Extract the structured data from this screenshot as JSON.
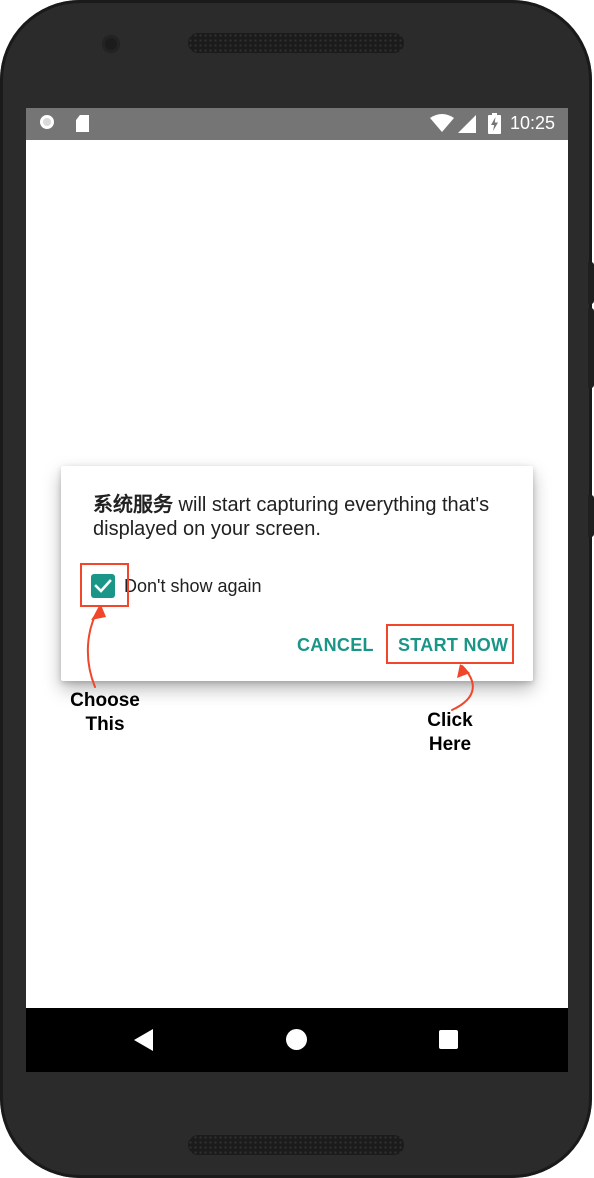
{
  "status_bar": {
    "time": "10:25",
    "icons": [
      "notification-circle-icon",
      "sd-card-icon",
      "wifi-icon",
      "signal-icon",
      "battery-charging-icon"
    ]
  },
  "dialog": {
    "app_name": "系统服务",
    "message": " will start capturing everything that's displayed on your screen.",
    "checkbox_label": "Don't show again",
    "checkbox_checked": true,
    "cancel_label": "CANCEL",
    "start_label": "START NOW",
    "accent_color": "#1a9688"
  },
  "nav_bar": {
    "icons": [
      "back-icon",
      "home-icon",
      "recents-icon"
    ]
  },
  "annotations": {
    "choose_line1": "Choose",
    "choose_line2": "This",
    "click_line1": "Click",
    "click_line2": "Here",
    "color": "#f1462a"
  }
}
